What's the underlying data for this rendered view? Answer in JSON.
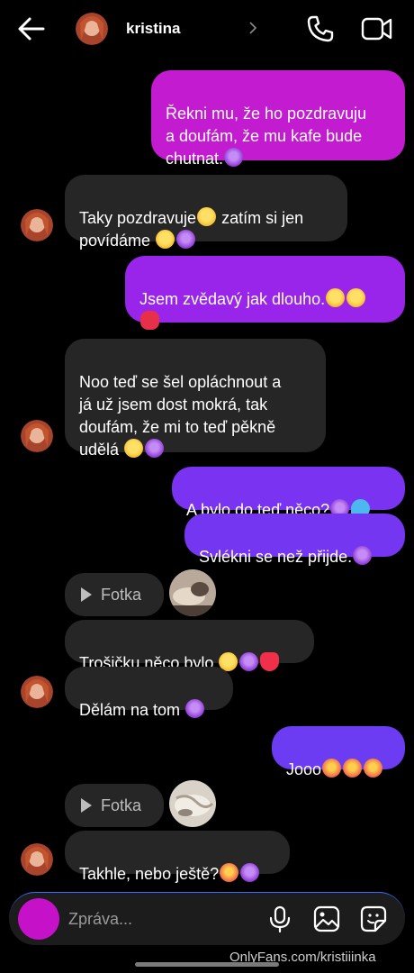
{
  "header": {
    "contact_name": "kristina",
    "icons": [
      "back-arrow-icon",
      "chevron-right-icon",
      "phone-icon",
      "video-icon"
    ]
  },
  "messages": [
    {
      "dir": "out",
      "text": "Řekni mu, že ho pozdravuju\na doufám, že mu kafe bude\nchutnat.",
      "emoji": [
        "smiling-devil"
      ]
    },
    {
      "dir": "in",
      "text": "Taky pozdravuje",
      "text2": " zatím si jen\npovídáme ",
      "emoji": [
        "smirk",
        "smirk",
        "smiling-devil"
      ]
    },
    {
      "dir": "out",
      "text": "Jsem zvědavý jak dlouho.",
      "emoji": [
        "squinting-tongue",
        "grin",
        "kiss-lips"
      ]
    },
    {
      "dir": "in",
      "text": "Noo teď se šel opláchnout a\njá už jsem dost mokrá,  tak\ndoufám, že mi to teď pěkně\nudělá ",
      "emoji": [
        "smirk",
        "smiling-devil"
      ]
    },
    {
      "dir": "out",
      "text": "A bylo do teď něco?",
      "emoji": [
        "smiling-devil",
        "sweat-droplets"
      ]
    },
    {
      "dir": "out",
      "text": "Svlékni se než přijde.",
      "emoji": [
        "smiling-devil"
      ]
    },
    {
      "dir": "in",
      "type": "photo",
      "label": "Fotka"
    },
    {
      "dir": "in",
      "text": "Trošičku něco bylo ",
      "emoji": [
        "hand-over-mouth",
        "smiling-devil",
        "red-heart"
      ]
    },
    {
      "dir": "in",
      "text": "Dělám na tom ",
      "emoji": [
        "smiling-devil"
      ]
    },
    {
      "dir": "out",
      "text": "Jooo",
      "emoji": [
        "hot-face",
        "hot-face",
        "hot-face"
      ]
    },
    {
      "dir": "in",
      "type": "photo",
      "label": "Fotka"
    },
    {
      "dir": "in",
      "text": "Takhle, nebo ještě?",
      "emoji": [
        "hot-face",
        "smiling-devil"
      ]
    }
  ],
  "composer": {
    "placeholder": "Zpráva...",
    "icons": [
      "camera-icon",
      "microphone-icon",
      "image-icon",
      "sticker-icon"
    ]
  },
  "watermark": "OnlyFans.com/kristiiinka",
  "colors": {
    "background": "#000000",
    "incoming_bubble": "#262626",
    "outgoing_top": "#c21bd0",
    "outgoing_mid": "#8a2bf2",
    "outgoing_bottom": "#6b3cf2",
    "camera_button": "#c511c8"
  }
}
